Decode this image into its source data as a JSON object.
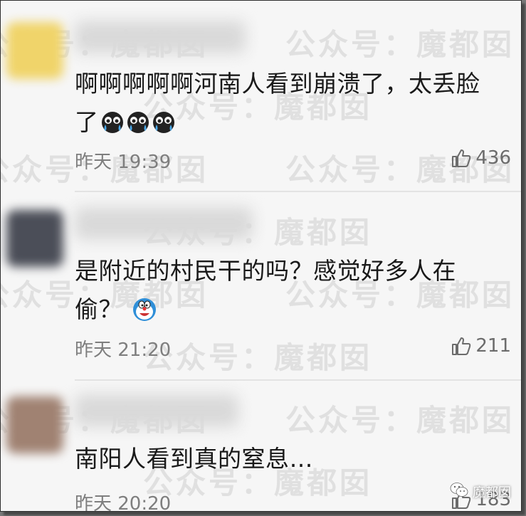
{
  "watermark": {
    "text": "公众号：魔都囡"
  },
  "comments": [
    {
      "text_line1": "啊啊啊啊啊河南人看到崩溃了，太丢脸",
      "text_line2": "了",
      "emoji_icon": "crying-face-icon",
      "time": "昨天 19:39",
      "likes": "436",
      "avatar_color": "#f0d46a"
    },
    {
      "text_line1": "是附近的村民干的吗？感觉好多人在",
      "text_line2": "偷？",
      "emoji_icon": "doraemon-icon",
      "time": "昨天 21:20",
      "likes": "211",
      "avatar_color": "#4b4e58"
    },
    {
      "text_line1": "南阳人看到真的窒息…",
      "time": "昨天 20:20",
      "likes": "183",
      "avatar_color": "#a08272"
    }
  ],
  "badge": {
    "icon": "wechat-icon",
    "label": "魔都囡"
  }
}
